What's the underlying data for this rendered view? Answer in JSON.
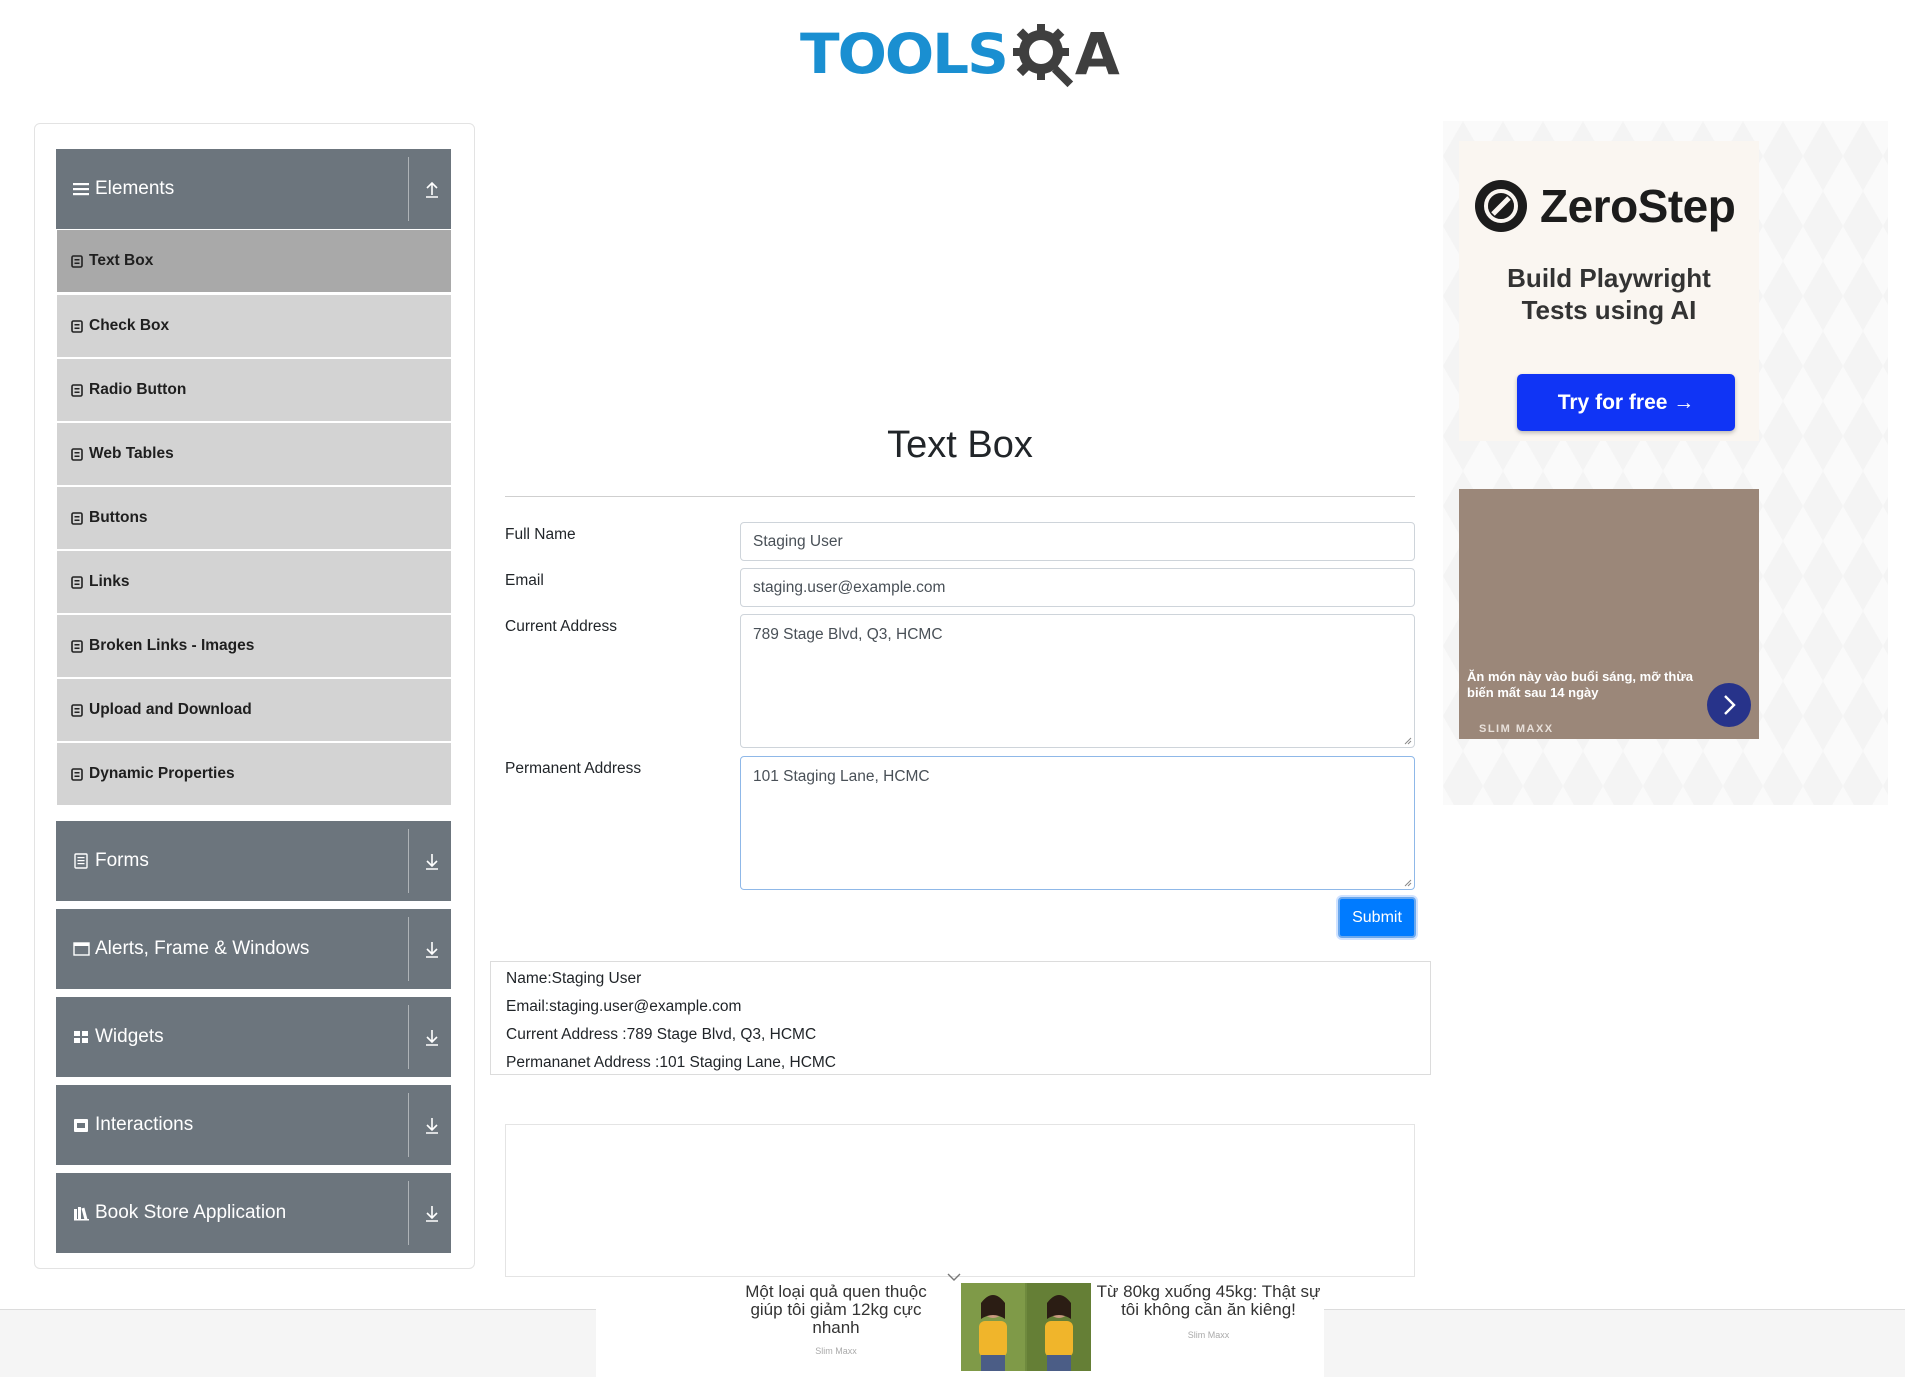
{
  "header": {
    "logo_text": "TOOLSQA"
  },
  "sidebar": {
    "groups": [
      {
        "label": "Elements",
        "icon": "hamburger-icon",
        "state": "expanded"
      },
      {
        "label": "Forms",
        "icon": "form-icon",
        "state": "collapsed"
      },
      {
        "label": "Alerts, Frame & Windows",
        "icon": "window-icon",
        "state": "collapsed"
      },
      {
        "label": "Widgets",
        "icon": "widgets-icon",
        "state": "collapsed"
      },
      {
        "label": "Interactions",
        "icon": "interactions-icon",
        "state": "collapsed"
      },
      {
        "label": "Book Store Application",
        "icon": "book-store-icon",
        "state": "collapsed"
      }
    ],
    "items": [
      {
        "label": "Text Box",
        "active": true
      },
      {
        "label": "Check Box"
      },
      {
        "label": "Radio Button"
      },
      {
        "label": "Web Tables"
      },
      {
        "label": "Buttons"
      },
      {
        "label": "Links"
      },
      {
        "label": "Broken Links - Images"
      },
      {
        "label": "Upload and Download"
      },
      {
        "label": "Dynamic Properties"
      }
    ]
  },
  "main": {
    "title": "Text Box",
    "form": {
      "full_name_label": "Full Name",
      "full_name_value": "Staging User",
      "email_label": "Email",
      "email_value": "staging.user@example.com",
      "current_address_label": "Current Address",
      "current_address_value": "789 Stage Blvd, Q3, HCMC",
      "permanent_address_label": "Permanent Address",
      "permanent_address_value": "101 Staging Lane, HCMC",
      "submit_label": "Submit"
    },
    "output": {
      "name": "Name:Staging User",
      "email": "Email:staging.user@example.com",
      "current_address": "Current Address :789 Stage Blvd, Q3, HCMC",
      "permanent_address": "Permananet Address :101 Staging Lane, HCMC"
    }
  },
  "ads": {
    "zerostep": {
      "brand": "ZeroStep",
      "tagline_line1": "Build Playwright",
      "tagline_line2": "Tests using AI",
      "cta": "Try for free →"
    },
    "slim_card": {
      "headline": "Ăn món này vào buổi sáng, mỡ thừa biến mất sau 14 ngày",
      "brand": "SLIM MAXX"
    },
    "bottom": {
      "left_text": "Một loại quả quen thuộc giúp tôi giảm 12kg cực nhanh",
      "left_source": "Slim Maxx",
      "right_text": "Từ 80kg xuống 45kg: Thật sự tôi không cần ăn kiêng!",
      "right_source": "Slim Maxx"
    }
  },
  "colors": {
    "brand_blue": "#1a8fd1",
    "sidebar_header": "#6c757d",
    "menu_item": "#d3d3d3",
    "menu_item_active": "#a9a9a9",
    "submit": "#007bff",
    "zerostep_cta": "#1034f5"
  }
}
